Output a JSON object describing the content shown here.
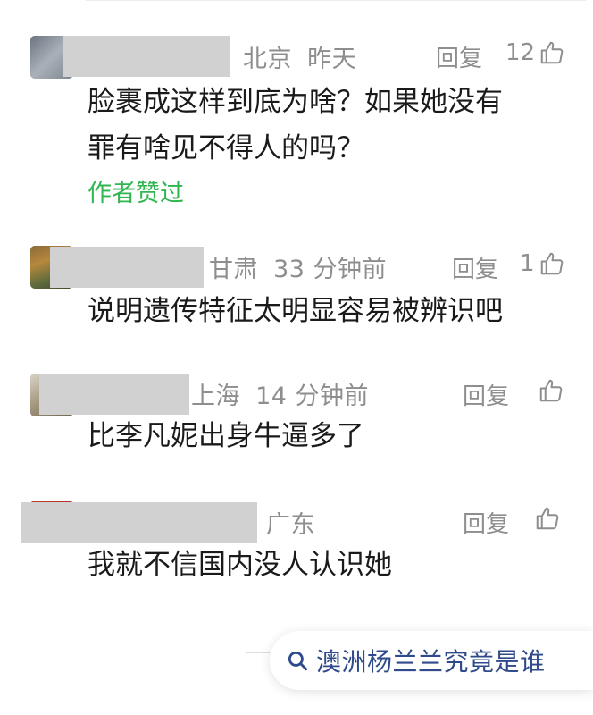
{
  "comments": [
    {
      "location": "北京",
      "time": "昨天",
      "reply_label": "回复",
      "like_count": "12",
      "text_lines": [
        "脸裹成这样到底为啥？如果她没有",
        "罪有啥见不得人的吗？"
      ],
      "author_liked": "作者赞过"
    },
    {
      "location": "甘肃",
      "time": "33 分钟前",
      "reply_label": "回复",
      "like_count": "1",
      "text_lines": [
        "说明遗传特征太明显容易被辨识吧"
      ]
    },
    {
      "location": "上海",
      "time": "14 分钟前",
      "reply_label": "回复",
      "like_count": "",
      "text_lines": [
        "比李凡妮出身牛逼多了"
      ]
    },
    {
      "location": "广东",
      "time": "",
      "reply_label": "回复",
      "like_count": "",
      "text_lines": [
        "我就不信国内没人认识她"
      ]
    }
  ],
  "search": {
    "icon": "search-icon",
    "text": "澳洲杨兰兰究竟是谁"
  },
  "colors": {
    "meta_gray": "#8e8e8e",
    "author_liked_green": "#2fb64f",
    "search_text_blue": "#2f4a8a",
    "name_mask_gray": "#d1d1d1"
  }
}
